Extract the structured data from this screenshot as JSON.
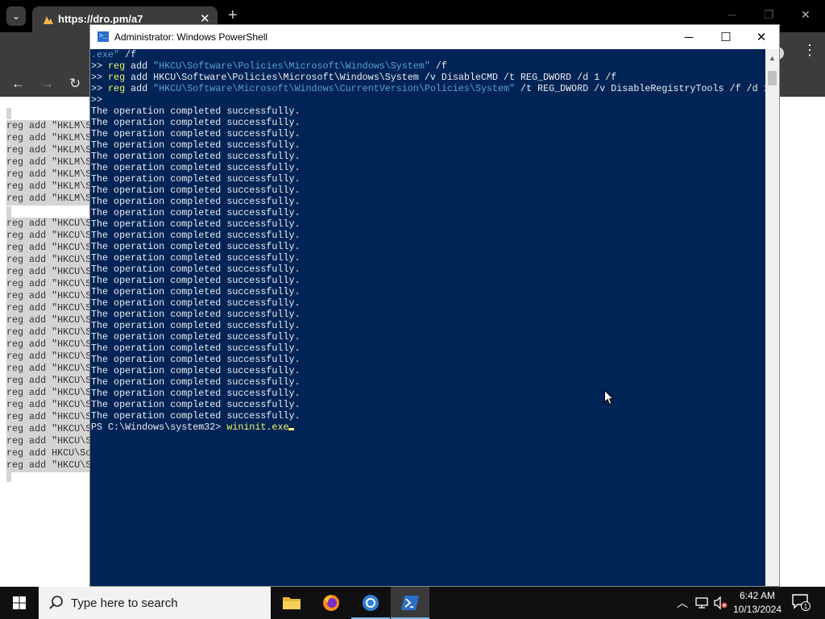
{
  "browser": {
    "tab_title": "https://dro.pm/a7",
    "tab_close": "✕",
    "new_tab": "+"
  },
  "page_code": {
    "hklm_lines": [
      "reg add \"HKLM\\S",
      "reg add \"HKLM\\S",
      "reg add \"HKLM\\S",
      "reg add \"HKLM\\S",
      "reg add \"HKLM\\S",
      "reg add \"HKLM\\S",
      "reg add \"HKLM\\S",
      "reg add \"HKLM\\S"
    ],
    "hkcu_lines": [
      "reg add \"HKCU\\S",
      "reg add \"HKCU\\S",
      "reg add \"HKCU\\S",
      "reg add \"HKCU\\S",
      "reg add \"HKCU\\S",
      "reg add \"HKCU\\S",
      "reg add \"HKCU\\S",
      "reg add \"HKCU\\S",
      "reg add \"HKCU\\S",
      "reg add \"HKCU\\S",
      "reg add \"HKCU\\S",
      "reg add \"HKCU\\S",
      "reg add \"HKCU\\S",
      "reg add \"HKCU\\S",
      "reg add \"HKCU\\S",
      "reg add \"HKCU\\S",
      "reg add \"HKCU\\S",
      "reg add \"HKCU\\S",
      "reg add \"HKCU\\S",
      "reg add HKCU\\So",
      "reg add \"HKCU\\S"
    ]
  },
  "powershell": {
    "title": "Administrator: Windows PowerShell",
    "icon_glyph": ">_",
    "minimize": "─",
    "maximize": "☐",
    "close": "✕",
    "line1_str": ".exe\"",
    "line1_rest": " /f",
    "line2_prompt": ">> ",
    "line2_cmd": "reg",
    "line2_add": " add ",
    "line2_str": "\"HKCU\\Software\\Policies\\Microsoft\\Windows\\System\"",
    "line2_rest": " /f",
    "line3_prompt": ">> ",
    "line3_cmd": "reg",
    "line3_rest": " add HKCU\\Software\\Policies\\Microsoft\\Windows\\System /v DisableCMD /t REG_DWORD /d 1 /f",
    "line4_prompt": ">> ",
    "line4_cmd": "reg",
    "line4_add": " add ",
    "line4_str": "\"HKCU\\Software\\Microsoft\\Windows\\CurrentVersion\\Policies\\System\"",
    "line4_rest": " /t REG_DWORD /v DisableRegistryTools /f /d 1",
    "line5": ">>",
    "success_message": "The operation completed successfully.",
    "success_count": 28,
    "prompt": "PS C:\\Windows\\system32> ",
    "typed_command": "wininit.exe"
  },
  "taskbar": {
    "search_placeholder": "Type here to search",
    "time": "6:42 AM",
    "date": "10/13/2024",
    "notification_count": "1"
  }
}
